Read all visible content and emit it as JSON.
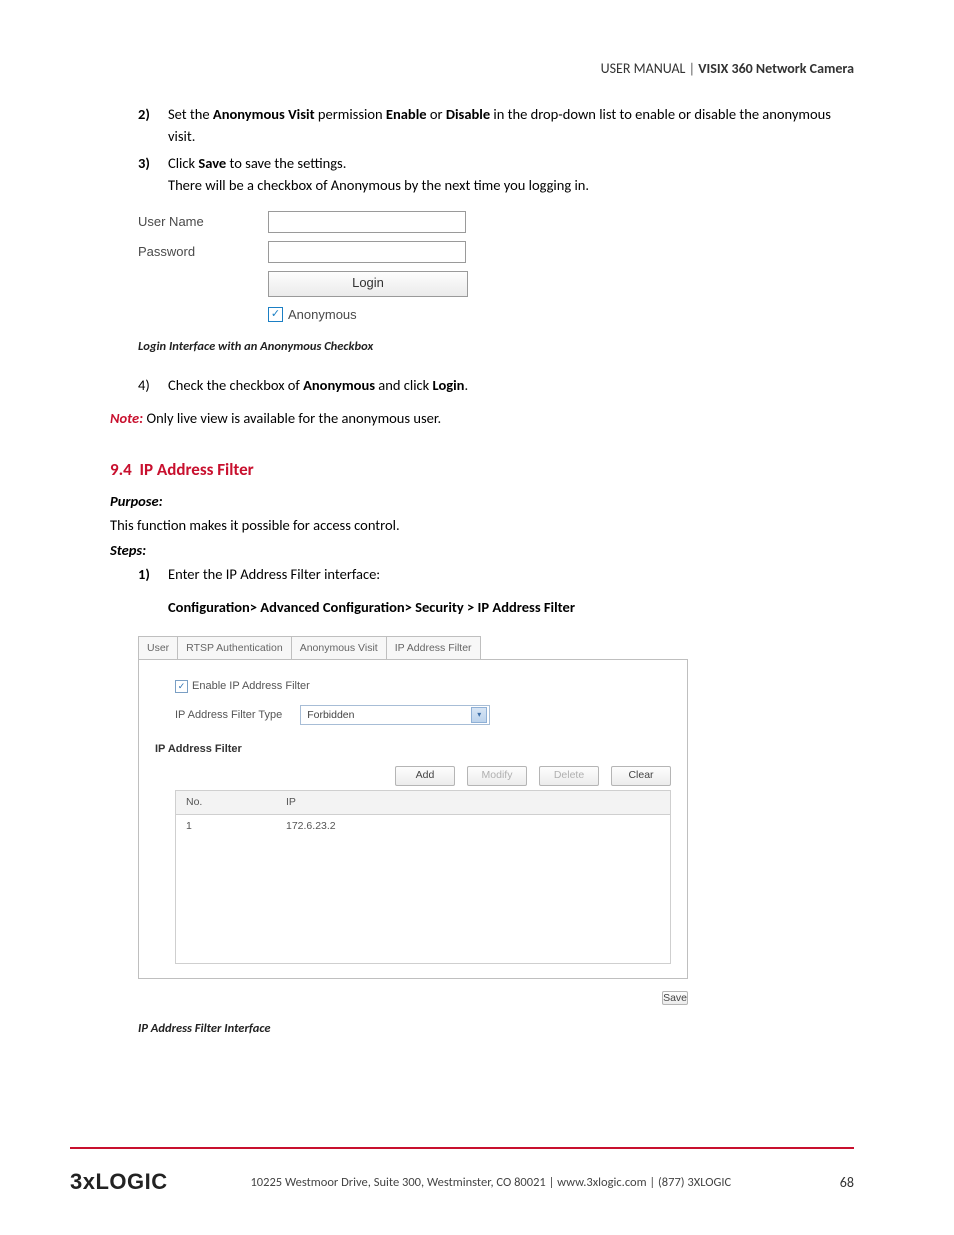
{
  "header": {
    "left": "USER MANUAL",
    "sep": "|",
    "right": "VISIX 360 Network Camera"
  },
  "steps_a": {
    "s2_num": "2)",
    "s2_a": "Set the ",
    "s2_b": "Anonymous Visit",
    "s2_c": " permission ",
    "s2_d": "Enable",
    "s2_e": " or ",
    "s2_f": "Disable",
    "s2_g": " in the drop-down list to enable or disable the anonymous visit.",
    "s3_num": "3)",
    "s3_a": "Click ",
    "s3_b": "Save",
    "s3_c": " to save the settings.",
    "s3_sub": "There will be a checkbox of Anonymous by the next time you logging in."
  },
  "login_fig": {
    "user_label": "User Name",
    "pass_label": "Password",
    "login_btn": "Login",
    "anon_label": "Anonymous",
    "check": "✓"
  },
  "caption1": "Login Interface with an Anonymous Checkbox",
  "steps_b": {
    "s4_num": "4)",
    "s4_a": "Check the checkbox of ",
    "s4_b": "Anonymous",
    "s4_c": " and click ",
    "s4_d": "Login",
    "s4_e": "."
  },
  "note": {
    "label": "Note:",
    "text": " Only live view is available for the anonymous user."
  },
  "section": {
    "num": "9.4",
    "title": "IP Address Filter",
    "purpose_label": "Purpose:",
    "purpose_text": "This function makes it possible for access control.",
    "steps_label": "Steps:",
    "s1_num": "1)",
    "s1_text": "Enter the IP Address Filter interface:",
    "nav_path": "Configuration> Advanced Configuration> Security > IP Address Filter"
  },
  "filter_fig": {
    "tabs": [
      "User",
      "RTSP Authentication",
      "Anonymous Visit",
      "IP Address Filter"
    ],
    "enable_check": "✓",
    "enable_label": "Enable IP Address Filter",
    "type_label": "IP Address Filter Type",
    "type_value": "Forbidden",
    "list_head": "IP Address Filter",
    "buttons": {
      "add": "Add",
      "modify": "Modify",
      "delete": "Delete",
      "clear": "Clear"
    },
    "cols": {
      "num": "No.",
      "ip": "IP"
    },
    "row": {
      "num": "1",
      "ip": "172.6.23.2"
    },
    "save": "Save"
  },
  "caption2": "IP Address Filter Interface",
  "footer": {
    "logo": "3xLOGIC",
    "addr": "10225 Westmoor Drive, Suite 300, Westminster, CO 80021 | www.3xlogic.com | (877) 3XLOGIC",
    "page": "68"
  }
}
